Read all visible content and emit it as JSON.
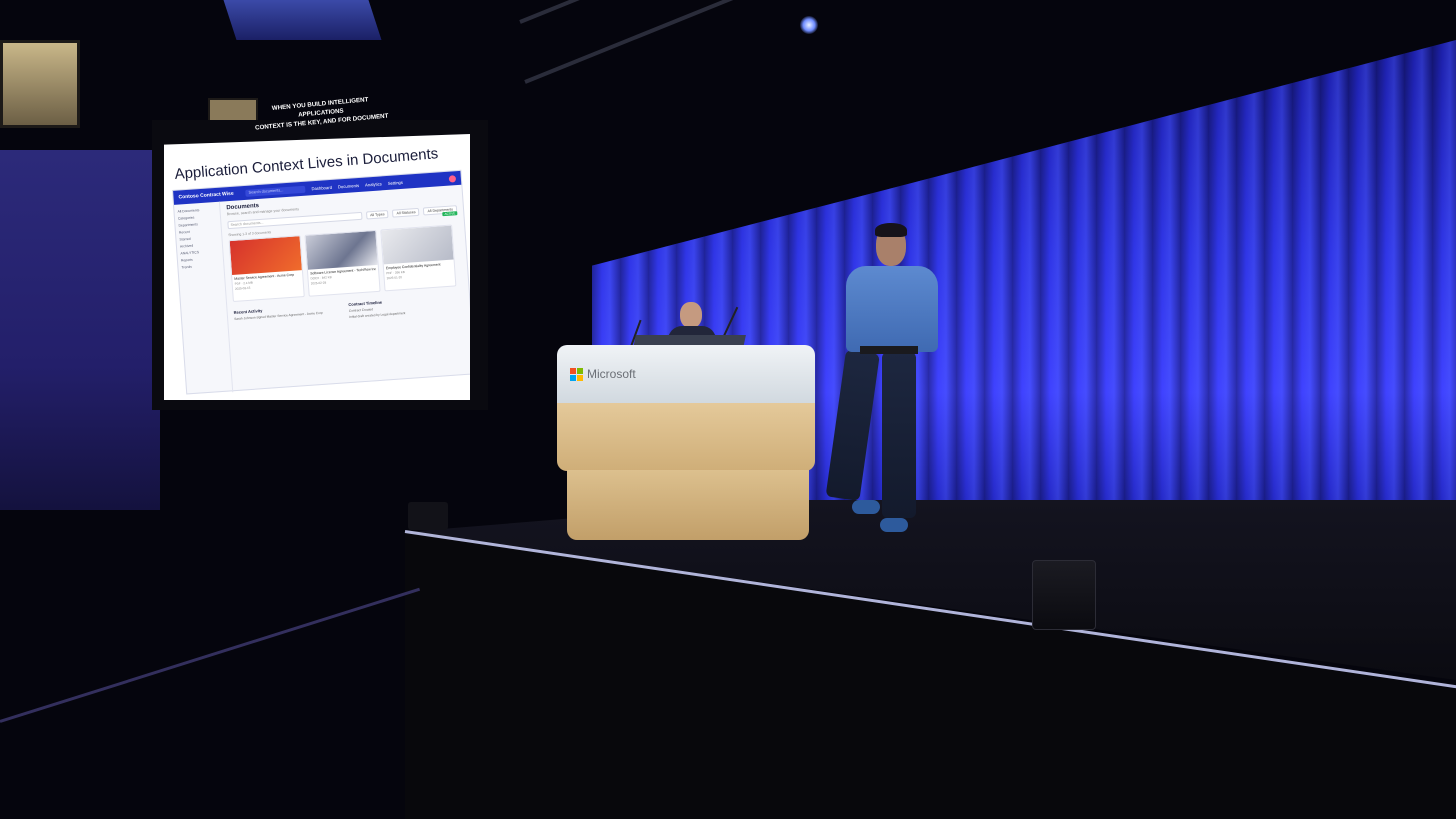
{
  "screen": {
    "caption_line1": "WHEN YOU BUILD INTELLIGENT APPLICATIONS",
    "caption_line2": "CONTEXT IS THE KEY, AND FOR DOCUMENT",
    "slide_title": "Application Context Lives in Documents",
    "app": {
      "brand": "Contoso Contract Wise",
      "search_placeholder": "Search documents...",
      "nav": [
        "Dashboard",
        "Documents",
        "Analytics",
        "Settings"
      ],
      "sidebar": [
        "All Documents",
        "Categories",
        "Departments",
        "Recent",
        "Starred",
        "Archived",
        "ANALYTICS",
        "Reports",
        "Trends"
      ],
      "heading": "Documents",
      "subheading": "Browse, search and manage your documents",
      "filter_search_placeholder": "Search documents...",
      "filters": [
        "All Types",
        "All Statuses",
        "All Departments"
      ],
      "badge": "ACTIVE",
      "count_text": "Showing 1-3 of 3 documents",
      "cards": [
        {
          "title": "Master Service Agreement - Acme Corp",
          "meta": "PDF · 2.4 MB",
          "date": "2025-03-15"
        },
        {
          "title": "Software License Agreement - TechFlow Inc",
          "meta": "DOCX · 842 KB",
          "date": "2025-02-28"
        },
        {
          "title": "Employee Confidentiality Agreement",
          "meta": "PDF · 356 KB",
          "date": "2025-01-20"
        }
      ],
      "recent_activity": {
        "title": "Recent Activity",
        "line": "Sarah Johnson signed Master Service Agreement - Acme Corp"
      },
      "timeline": {
        "title": "Contract Timeline",
        "line1": "Contract Created",
        "line2": "Initial draft created by Legal department"
      }
    }
  },
  "podium": {
    "brand": "Microsoft"
  },
  "colors": {
    "curtain": "#2f35e6",
    "ms_red": "#f25022",
    "ms_green": "#7fba00",
    "ms_blue": "#00a4ef",
    "ms_yellow": "#ffb900"
  }
}
